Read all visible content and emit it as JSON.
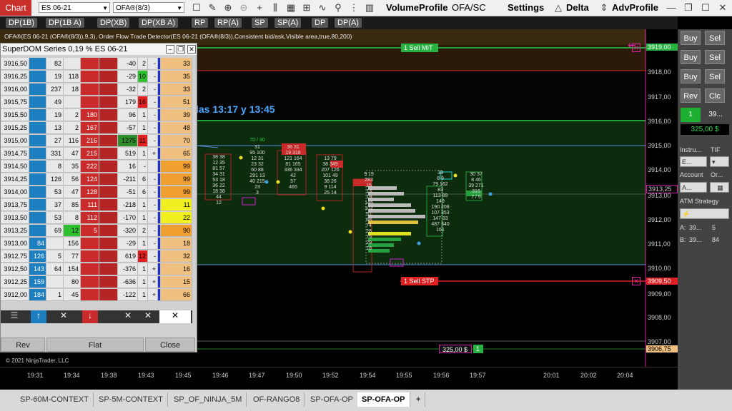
{
  "toolbar": {
    "chart_label": "Chart",
    "instrument": "ES 06-21",
    "bar_type": "OFA®(8/3)",
    "volume_profile": "VolumeProfile",
    "ofa_sc": "OFA/SC",
    "settings": "Settings",
    "delta": "Delta",
    "adv_profile": "AdvProfile"
  },
  "dp_buttons": [
    "DP(1B)",
    "DP(1B A)",
    "DP(XB)",
    "DP(XB A)",
    "RP",
    "RP(A)",
    "SP",
    "SP(A)",
    "DP",
    "DP(A)"
  ],
  "chart": {
    "indicator_line": "OFA®(ES 06-21 (OFA®(8/3)),9,3), Order Flow Trade Detector(ES 06-21 (OFA®(8/3)),Consistent bid/ask,Visible area,true,80,200)",
    "annotation": "las 13:17 y  13:45",
    "sell_mit": "1  Sell MIT",
    "sell_stp": "1  Sell STP",
    "position_pnl": "325,00 $",
    "position_qty": "1",
    "copyright": "© 2021 NinjaTrader, LLC"
  },
  "price_axis": [
    "3919,00",
    "3918,00",
    "3917,00",
    "3916,00",
    "3915,00",
    "3914,00",
    "3913,25",
    "3913,00",
    "3912,00",
    "3911,00",
    "3910,00",
    "3909,50",
    "3909,00",
    "3908,00",
    "3907,00",
    "3906,75"
  ],
  "time_axis": [
    "19:31",
    "19:34",
    "19:38",
    "19:43",
    "19:45",
    "19:46",
    "19:47",
    "19:50",
    "19:52",
    "19:54",
    "19:55",
    "19:56",
    "19:57",
    "20:01",
    "20:02",
    "20:04"
  ],
  "superdom": {
    "title": "SuperDOM Series 0,19 % ES 06-21",
    "buttons": {
      "rev": "Rev",
      "flat": "Flat",
      "close": "Close"
    },
    "rows": [
      {
        "price": "3916,50",
        "c1": "",
        "c2": "82",
        "c3": "",
        "c4": "",
        "c5": "-40",
        "c6": "2",
        "c7": "-",
        "c8": "33"
      },
      {
        "price": "3916,25",
        "c1": "",
        "c2": "19",
        "c3": "118",
        "c4": "",
        "c5": "-29",
        "c6": "10",
        "c7": "-",
        "c8": "35"
      },
      {
        "price": "3916,00",
        "c1": "",
        "c2": "237",
        "c3": "18",
        "c4": "",
        "c5": "-32",
        "c6": "2",
        "c7": "-",
        "c8": "33"
      },
      {
        "price": "3915,75",
        "c1": "",
        "c2": "49",
        "c3": "",
        "c4": "",
        "c5": "179",
        "c6": "16",
        "c7": "-",
        "c8": "51"
      },
      {
        "price": "3915,50",
        "c1": "",
        "c2": "19",
        "c3": "2",
        "c4": "180",
        "c5": "96",
        "c6": "1",
        "c7": "-",
        "c8": "39"
      },
      {
        "price": "3915,25",
        "c1": "",
        "c2": "13",
        "c3": "2",
        "c4": "167",
        "c5": "-57",
        "c6": "1",
        "c7": "-",
        "c8": "48"
      },
      {
        "price": "3915,00",
        "c1": "",
        "c2": "27",
        "c3": "116",
        "c4": "216",
        "c5": "1275",
        "c6": "11",
        "c7": "-",
        "c8": "70"
      },
      {
        "price": "3914,75",
        "c1": "",
        "c2": "331",
        "c3": "47",
        "c4": "215",
        "c5": "519",
        "c6": "1",
        "c7": "+",
        "c8": "65"
      },
      {
        "price": "3914,50",
        "c1": "",
        "c2": "8",
        "c3": "35",
        "c4": "222",
        "c5": "16",
        "c6": "-",
        "c7": "",
        "c8": "99"
      },
      {
        "price": "3914,25",
        "c1": "",
        "c2": "126",
        "c3": "56",
        "c4": "124",
        "c5": "-211",
        "c6": "6",
        "c7": "-",
        "c8": "99"
      },
      {
        "price": "3914,00",
        "c1": "",
        "c2": "53",
        "c3": "47",
        "c4": "128",
        "c5": "-51",
        "c6": "6",
        "c7": "-",
        "c8": "99"
      },
      {
        "price": "3913,75",
        "c1": "",
        "c2": "37",
        "c3": "85",
        "c4": "111",
        "c5": "-218",
        "c6": "1",
        "c7": "-",
        "c8": "11"
      },
      {
        "price": "3913,50",
        "c1": "",
        "c2": "53",
        "c3": "8",
        "c4": "112",
        "c5": "-170",
        "c6": "1",
        "c7": "-",
        "c8": "22"
      },
      {
        "price": "3913,25",
        "c1": "",
        "c2": "69",
        "c3": "12",
        "c4": "5",
        "c5": "-320",
        "c6": "2",
        "c7": "-",
        "c8": "90"
      },
      {
        "price": "3913,00",
        "c1": "84",
        "c2": "",
        "c3": "156",
        "c4": "",
        "c5": "-29",
        "c6": "1",
        "c7": "-",
        "c8": "18"
      },
      {
        "price": "3912,75",
        "c1": "126",
        "c2": "5",
        "c3": "77",
        "c4": "",
        "c5": "619",
        "c6": "12",
        "c7": "-",
        "c8": "32"
      },
      {
        "price": "3912,50",
        "c1": "143",
        "c2": "64",
        "c3": "154",
        "c4": "",
        "c5": "-376",
        "c6": "1",
        "c7": "+",
        "c8": "16"
      },
      {
        "price": "3912,25",
        "c1": "159",
        "c2": "",
        "c3": "80",
        "c4": "",
        "c5": "-636",
        "c6": "1",
        "c7": "+",
        "c8": "15"
      },
      {
        "price": "3912,00",
        "c1": "184",
        "c2": "1",
        "c3": "45",
        "c4": "",
        "c5": "-122",
        "c6": "1",
        "c7": "+",
        "c8": "66"
      }
    ]
  },
  "right_panel": {
    "buy": "Buy",
    "sell": "Sel",
    "rev": "Rev",
    "close": "Clc",
    "qty": "1",
    "qty_val": "39...",
    "pnl": "325,00 $",
    "instrument_label": "Instru...",
    "tif_label": "TIF",
    "instrument_val": "E...",
    "account_label": "Account",
    "order_label": "Or...",
    "account_val": "A...",
    "atm_label": "ATM Strategy",
    "a_label": "A:",
    "a_val": "39...",
    "a_num": "5",
    "b_label": "B:",
    "b_val": "39...",
    "b_num": "84"
  },
  "tabs": [
    "SP-60M-CONTEXT",
    "SP-5M-CONTEXT",
    "SP_OF_NINJA_5M",
    "OF-RANGO8",
    "SP-OFA-OP",
    "SP-OFA-OP"
  ],
  "colors": {
    "sell_red": "#e02020",
    "buy_green": "#1e9e3a",
    "ask_blue": "#1e7fc0",
    "dom_red": "#c92a2a",
    "accent_orange": "#f0a030"
  }
}
